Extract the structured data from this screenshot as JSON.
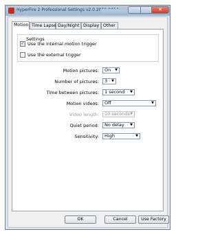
{
  "window": {
    "title": "HyperFire 2 Professional Settings v2.0.2019-0414"
  },
  "tabs": [
    {
      "label": "Motion"
    },
    {
      "label": "Time Lapse"
    },
    {
      "label": "Day/Night"
    },
    {
      "label": "Display"
    },
    {
      "label": "Other"
    }
  ],
  "settings": {
    "group_label": "Settings",
    "internal_trigger": {
      "label": "Use the internal motion trigger",
      "checked": true
    },
    "external_trigger": {
      "label": "Use the external trigger",
      "checked": false
    }
  },
  "fields": [
    {
      "label": "Motion pictures:",
      "value": "On",
      "enabled": true
    },
    {
      "label": "Number of pictures:",
      "value": "3",
      "enabled": true
    },
    {
      "label": "Time between pictures:",
      "value": "1 second",
      "enabled": true
    },
    {
      "label": "Motion videos:",
      "value": "Off",
      "enabled": true
    },
    {
      "label": "Video length:",
      "value": "10 seconds",
      "enabled": false
    },
    {
      "label": "Quiet period:",
      "value": "No delay",
      "enabled": true
    },
    {
      "label": "Sensitivity:",
      "value": "High",
      "enabled": true
    }
  ],
  "buttons": {
    "ok": "OK",
    "cancel": "Cancel",
    "use_factory": "Use Factory"
  },
  "icons": {
    "checkmark": "✓",
    "dropdown": "▼",
    "close": "✕"
  }
}
